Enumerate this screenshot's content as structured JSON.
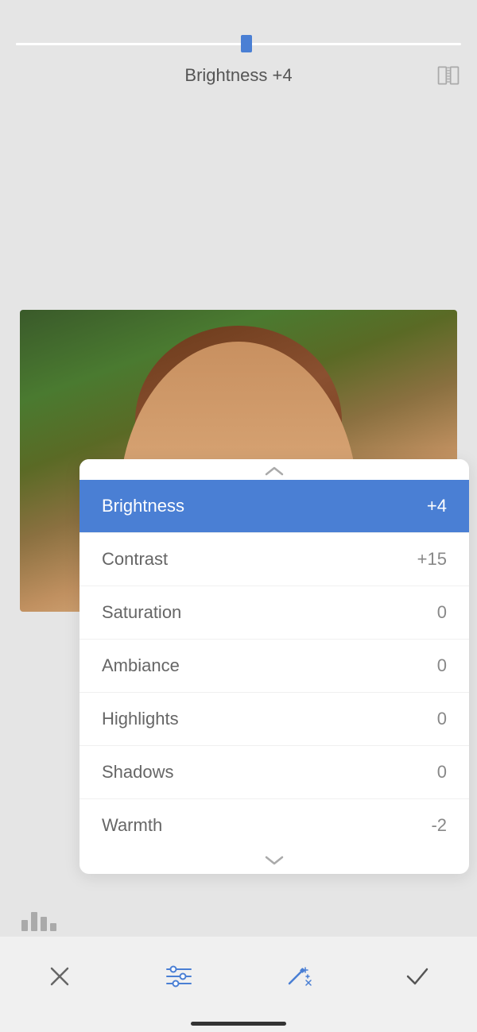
{
  "slider": {
    "label": "Brightness +4",
    "value": 4,
    "percent": 52
  },
  "compare_icon_label": "compare",
  "panel": {
    "chevron_up": "^",
    "chevron_down": "v",
    "items": [
      {
        "label": "Brightness",
        "value": "+4",
        "active": true
      },
      {
        "label": "Contrast",
        "value": "+15",
        "active": false
      },
      {
        "label": "Saturation",
        "value": "0",
        "active": false
      },
      {
        "label": "Ambiance",
        "value": "0",
        "active": false
      },
      {
        "label": "Highlights",
        "value": "0",
        "active": false
      },
      {
        "label": "Shadows",
        "value": "0",
        "active": false
      },
      {
        "label": "Warmth",
        "value": "-2",
        "active": false
      }
    ]
  },
  "toolbar": {
    "cancel_label": "×",
    "adjustments_label": "adjustments",
    "auto_label": "auto",
    "confirm_label": "✓"
  }
}
